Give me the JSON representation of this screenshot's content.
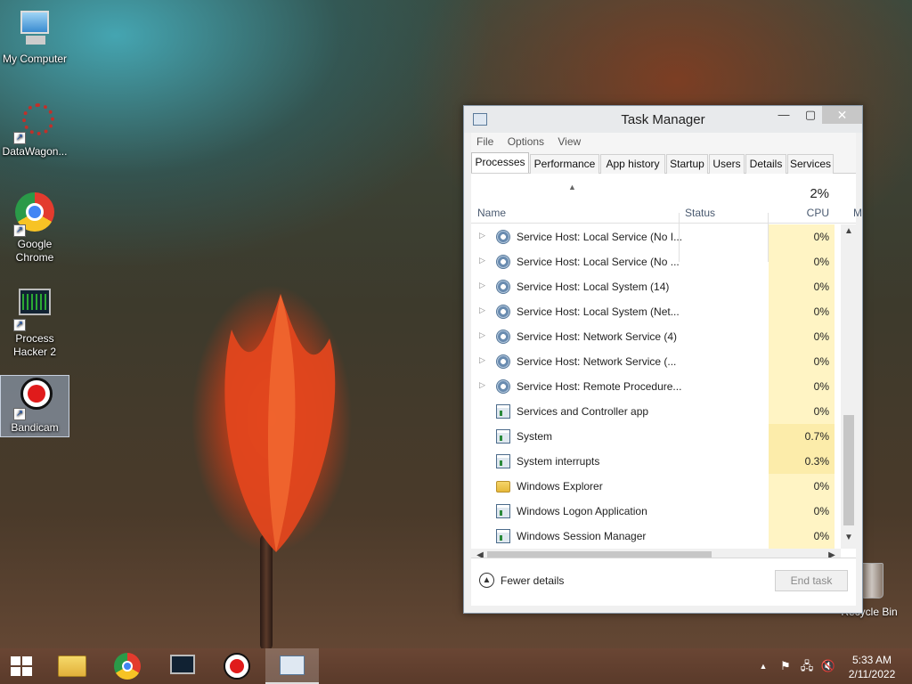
{
  "desktop": {
    "icons": [
      {
        "label": "My Computer"
      },
      {
        "label": "DataWagon..."
      },
      {
        "label": "Google Chrome"
      },
      {
        "label": "Process Hacker 2"
      },
      {
        "label": "Bandicam"
      }
    ],
    "recycle_bin": "Recycle Bin"
  },
  "task_manager": {
    "title": "Task Manager",
    "controls": {
      "minimize": "—",
      "maximize": "▢",
      "close": "✕"
    },
    "menu": [
      "File",
      "Options",
      "View"
    ],
    "tabs": [
      "Processes",
      "Performance",
      "App history",
      "Startup",
      "Users",
      "Details",
      "Services"
    ],
    "active_tab": "Processes",
    "columns": {
      "name": "Name",
      "status": "Status",
      "cpu_pct": "2%",
      "cpu": "CPU",
      "memory_partial": "M"
    },
    "rows": [
      {
        "name": "Service Host: Local Service (No I...",
        "cpu": "0%",
        "expandable": true,
        "icon": "gear-icon"
      },
      {
        "name": "Service Host: Local Service (No ...",
        "cpu": "0%",
        "expandable": true,
        "icon": "gear-icon"
      },
      {
        "name": "Service Host: Local System (14)",
        "cpu": "0%",
        "expandable": true,
        "icon": "gear-icon"
      },
      {
        "name": "Service Host: Local System (Net...",
        "cpu": "0%",
        "expandable": true,
        "icon": "gear-icon"
      },
      {
        "name": "Service Host: Network Service (4)",
        "cpu": "0%",
        "expandable": true,
        "icon": "gear-icon"
      },
      {
        "name": "Service Host: Network Service (...",
        "cpu": "0%",
        "expandable": true,
        "icon": "gear-icon"
      },
      {
        "name": "Service Host: Remote Procedure...",
        "cpu": "0%",
        "expandable": true,
        "icon": "gear-icon"
      },
      {
        "name": "Services and Controller app",
        "cpu": "0%",
        "expandable": false,
        "icon": "service-app-icon"
      },
      {
        "name": "System",
        "cpu": "0.7%",
        "expandable": false,
        "icon": "service-app-icon"
      },
      {
        "name": "System interrupts",
        "cpu": "0.3%",
        "expandable": false,
        "icon": "service-app-icon"
      },
      {
        "name": "Windows Explorer",
        "cpu": "0%",
        "expandable": false,
        "icon": "folder-icon"
      },
      {
        "name": "Windows Logon Application",
        "cpu": "0%",
        "expandable": false,
        "icon": "service-app-icon"
      },
      {
        "name": "Windows Session Manager",
        "cpu": "0%",
        "expandable": false,
        "icon": "service-app-icon"
      }
    ],
    "footer": {
      "fewer_details": "Fewer details",
      "end_task": "End task"
    }
  },
  "taskbar": {
    "clock_time": "5:33 AM",
    "clock_date": "2/11/2022",
    "pinned": [
      "file-explorer-icon",
      "chrome-icon",
      "process-hacker-icon",
      "bandicam-icon",
      "task-manager-icon"
    ]
  }
}
